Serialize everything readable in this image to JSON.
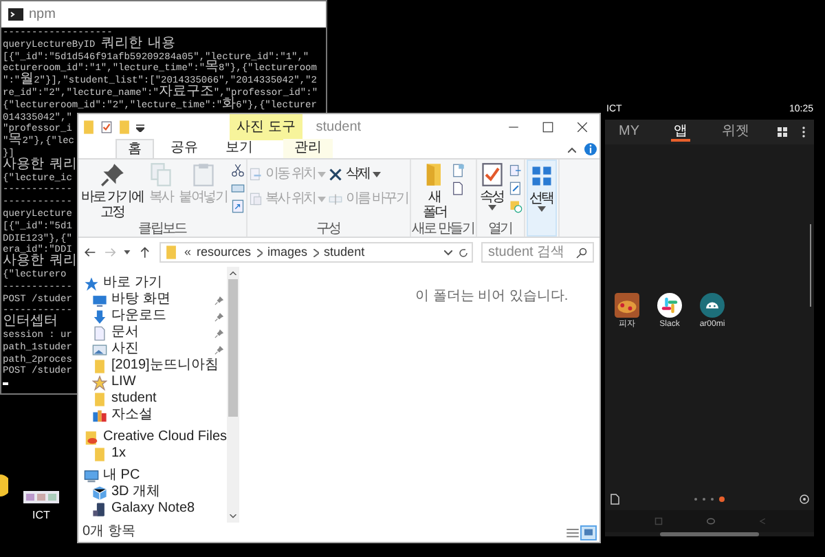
{
  "console": {
    "title": "npm",
    "lines": [
      "-------------------",
      "queryLectureByID 쿼리한 내용",
      "[{\"_id\":\"5d1d546f91afb59209284a05\",\"lecture_id\":\"1\",\"",
      "ectureroom_id\":\"1\",\"lecture_time\":\"목8\"},{\"lectureroom",
      "\":\"월2\"}],\"student_list\":[\"2014335066\",\"2014335042\",\"2",
      "re_id\":\"2\",\"lecture_name\":\"자료구조\",\"professor_id\":\"",
      "{\"lectureroom_id\":\"2\",\"lecture_time\":\"화6\"},{\"lecturer",
      "014335042\",\"",
      "\"professor_i",
      "\"목2\"},{\"lec",
      "}]",
      "사용한 쿼리",
      "{\"lecture_ic",
      "------------",
      "------------",
      "queryLecture",
      "[{\"_id\":\"5d1",
      "DDIE123\"},{\"",
      "era_id\":\"DDI",
      "사용한 쿼리",
      "{\"lecturero",
      "------------",
      "POST /studer",
      "------------",
      "인터셉터",
      "session : ur",
      "path_1studer",
      "path_2proces",
      "POST /studer"
    ]
  },
  "desktop_icons": [
    {
      "kind": "coin"
    },
    {
      "kind": "thumbnail",
      "label": "ICT"
    }
  ],
  "explorer": {
    "context_tab": "사진 도구",
    "title": "student",
    "tabs": [
      {
        "label": "홈",
        "selected": true
      },
      {
        "label": "공유",
        "selected": false
      },
      {
        "label": "보기",
        "selected": false
      },
      {
        "label": "관리",
        "selected": false
      }
    ],
    "ribbon_groups": [
      {
        "kind": "clipboard",
        "label": "클립보드",
        "buttons": [
          {
            "label": "바로 가기에\n고정",
            "disabled": false,
            "dropdown": false
          },
          {
            "label": "복사",
            "disabled": true,
            "dropdown": false
          },
          {
            "label": "붙여넣기",
            "disabled": true,
            "dropdown": false
          }
        ]
      },
      {
        "kind": "organize",
        "label": "구성",
        "buttons": [
          {
            "label": "이동 위치",
            "disabled": true,
            "dropdown": true
          },
          {
            "label": "복사 위치",
            "disabled": true,
            "dropdown": true
          },
          {
            "label": "삭제",
            "disabled": false,
            "dropdown": true
          },
          {
            "label": "이름 바꾸기",
            "disabled": true,
            "dropdown": false
          }
        ]
      },
      {
        "kind": "new",
        "label": "새로 만들기",
        "buttons": [
          {
            "label": "새\n폴더",
            "disabled": false,
            "dropdown": false
          }
        ]
      },
      {
        "kind": "open",
        "label": "열기",
        "buttons": [
          {
            "label": "속성",
            "disabled": false,
            "dropdown": true
          }
        ]
      },
      {
        "kind": "select",
        "buttons": [
          {
            "label": "선택",
            "disabled": false,
            "dropdown": true
          }
        ]
      }
    ],
    "address": {
      "overflow_mark": "«",
      "crumbs": [
        "resources",
        "images",
        "student"
      ]
    },
    "search": {
      "placeholder": "student 검색"
    },
    "nav": [
      {
        "kind": "star",
        "label": "바로 가기",
        "pinned": false,
        "children": [
          {
            "kind": "desktop",
            "label": "바탕 화면",
            "pinned": true
          },
          {
            "kind": "download",
            "label": "다운로드",
            "pinned": true
          },
          {
            "kind": "document",
            "label": "문서",
            "pinned": true
          },
          {
            "kind": "pictures",
            "label": "사진",
            "pinned": true
          },
          {
            "kind": "folder",
            "label": "[2019]눈뜨니아침",
            "pinned": false
          },
          {
            "kind": "favorite",
            "label": "LIW",
            "pinned": false
          },
          {
            "kind": "folder",
            "label": "student",
            "pinned": false
          },
          {
            "kind": "app",
            "label": "자소설",
            "pinned": false
          }
        ]
      },
      {
        "kind": "cloud",
        "label": "Creative Cloud Files",
        "pinned": false,
        "children": [
          {
            "kind": "folder",
            "label": "1x",
            "pinned": false
          }
        ]
      },
      {
        "kind": "pc",
        "label": "내 PC",
        "pinned": false,
        "children": [
          {
            "kind": "cube",
            "label": "3D 개체",
            "pinned": false
          },
          {
            "kind": "phone",
            "label": "Galaxy Note8",
            "pinned": false
          }
        ]
      }
    ],
    "empty_message": "이 폴더는 비어 있습니다.",
    "status": "0개 항목",
    "views": [
      {
        "kind": "details",
        "selected": false
      },
      {
        "kind": "thumbnails",
        "selected": true
      }
    ]
  },
  "phone": {
    "carrier": "ICT",
    "time": "10:25",
    "tabs": [
      {
        "label": "MY",
        "selected": false
      },
      {
        "label": "앱",
        "selected": true
      },
      {
        "label": "위젯",
        "selected": false
      }
    ],
    "apps": [
      {
        "kind": "pizza",
        "label": "피자"
      },
      {
        "kind": "slack",
        "label": "Slack"
      },
      {
        "kind": "android",
        "label": "ar00mi"
      }
    ],
    "pages": [
      {
        "selected": false
      },
      {
        "selected": false
      },
      {
        "selected": false
      },
      {
        "selected": true
      }
    ]
  }
}
